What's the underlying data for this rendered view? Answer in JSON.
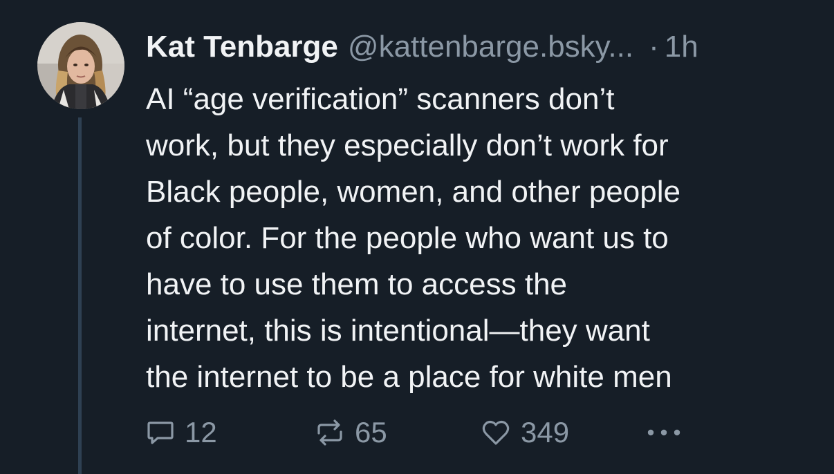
{
  "post": {
    "author": {
      "name": "Kat Tenbarge",
      "handle": "@kattenbarge.bsky...",
      "avatar_icon": "user-avatar-photo"
    },
    "separator": "·",
    "time": "1h",
    "text": "AI “age verification” scanners don’t\nwork, but they especially don’t work for\nBlack people, women, and other people\nof color. For the people who want us to\nhave to use them to access the\ninternet, this is intentional—they want\nthe internet to be a place for white men",
    "actions": {
      "replies": {
        "count": "12",
        "icon": "reply-icon"
      },
      "reposts": {
        "count": "65",
        "icon": "repost-icon"
      },
      "likes": {
        "count": "349",
        "icon": "heart-icon"
      },
      "more": {
        "icon": "more-options-icon"
      }
    }
  },
  "colors": {
    "background": "#161e27",
    "primary_text": "#f1f3f5",
    "secondary_text": "#8b98a5",
    "thread_line": "#2e4052"
  }
}
